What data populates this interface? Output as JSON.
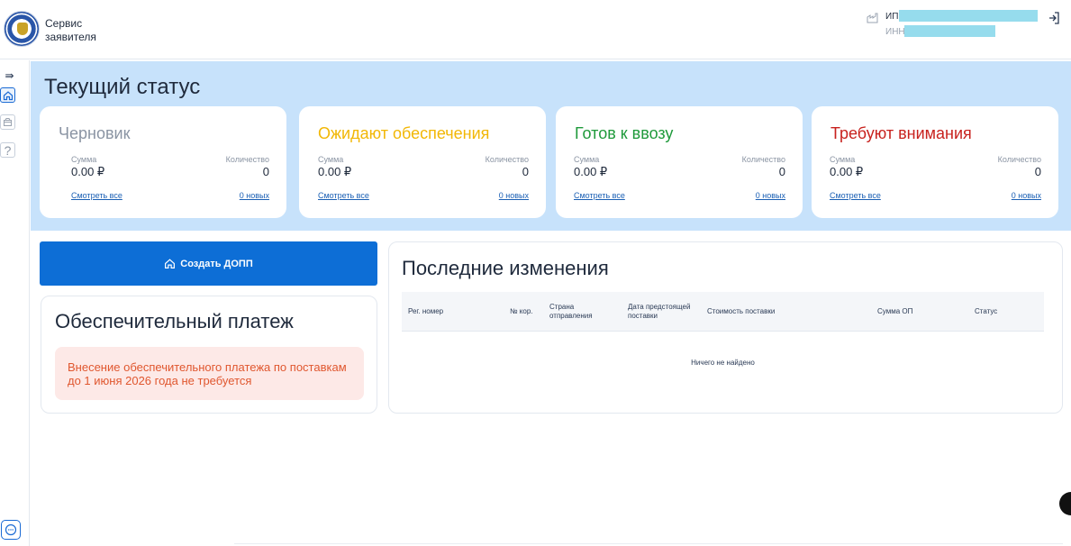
{
  "header": {
    "brand_line1": "Сервис",
    "brand_line2": "заявителя",
    "user_prefix": "ИП",
    "inn_prefix": "ИНН",
    "redaction_color": "#96dced"
  },
  "sidebar": {
    "expand_icon": "⇛",
    "items": [
      "home-icon",
      "box-icon",
      "help-icon"
    ],
    "help_glyph": "?"
  },
  "status": {
    "title": "Текущий статус",
    "cards": [
      {
        "title": "Черновик",
        "title_color": "#8a94a3",
        "sum_label": "Сумма",
        "sum": "0.00 ₽",
        "count_label": "Количество",
        "count": "0",
        "link_all": "Смотреть все",
        "link_new": "0 новых"
      },
      {
        "title": "Ожидают обеспечения",
        "title_color": "#f2b705",
        "sum_label": "Сумма",
        "sum": "0.00 ₽",
        "count_label": "Количество",
        "count": "0",
        "link_all": "Смотреть все",
        "link_new": "0 новых"
      },
      {
        "title": "Готов к ввозу",
        "title_color": "#1f9a3b",
        "sum_label": "Сумма",
        "sum": "0.00 ₽",
        "count_label": "Количество",
        "count": "0",
        "link_all": "Смотреть все",
        "link_new": "0 новых"
      },
      {
        "title": "Требуют внимания",
        "title_color": "#c8221e",
        "sum_label": "Сумма",
        "sum": "0.00 ₽",
        "count_label": "Количество",
        "count": "0",
        "link_all": "Смотреть все",
        "link_new": "0 новых"
      }
    ]
  },
  "create_button": {
    "label": "Создать ДОПП"
  },
  "payment": {
    "title": "Обеспечительный платеж",
    "note": "Внесение обеспечительного платежа по поставкам до 1 июня 2026 года не требуется"
  },
  "changes": {
    "title": "Последние изменения",
    "columns": [
      "Рег. номер",
      "№ кор.",
      "Страна отправления",
      "Дата предстоящей поставки",
      "Стоимость поставки",
      "Сумма ОП",
      "Статус"
    ],
    "empty_text": "Ничего не найдено"
  }
}
